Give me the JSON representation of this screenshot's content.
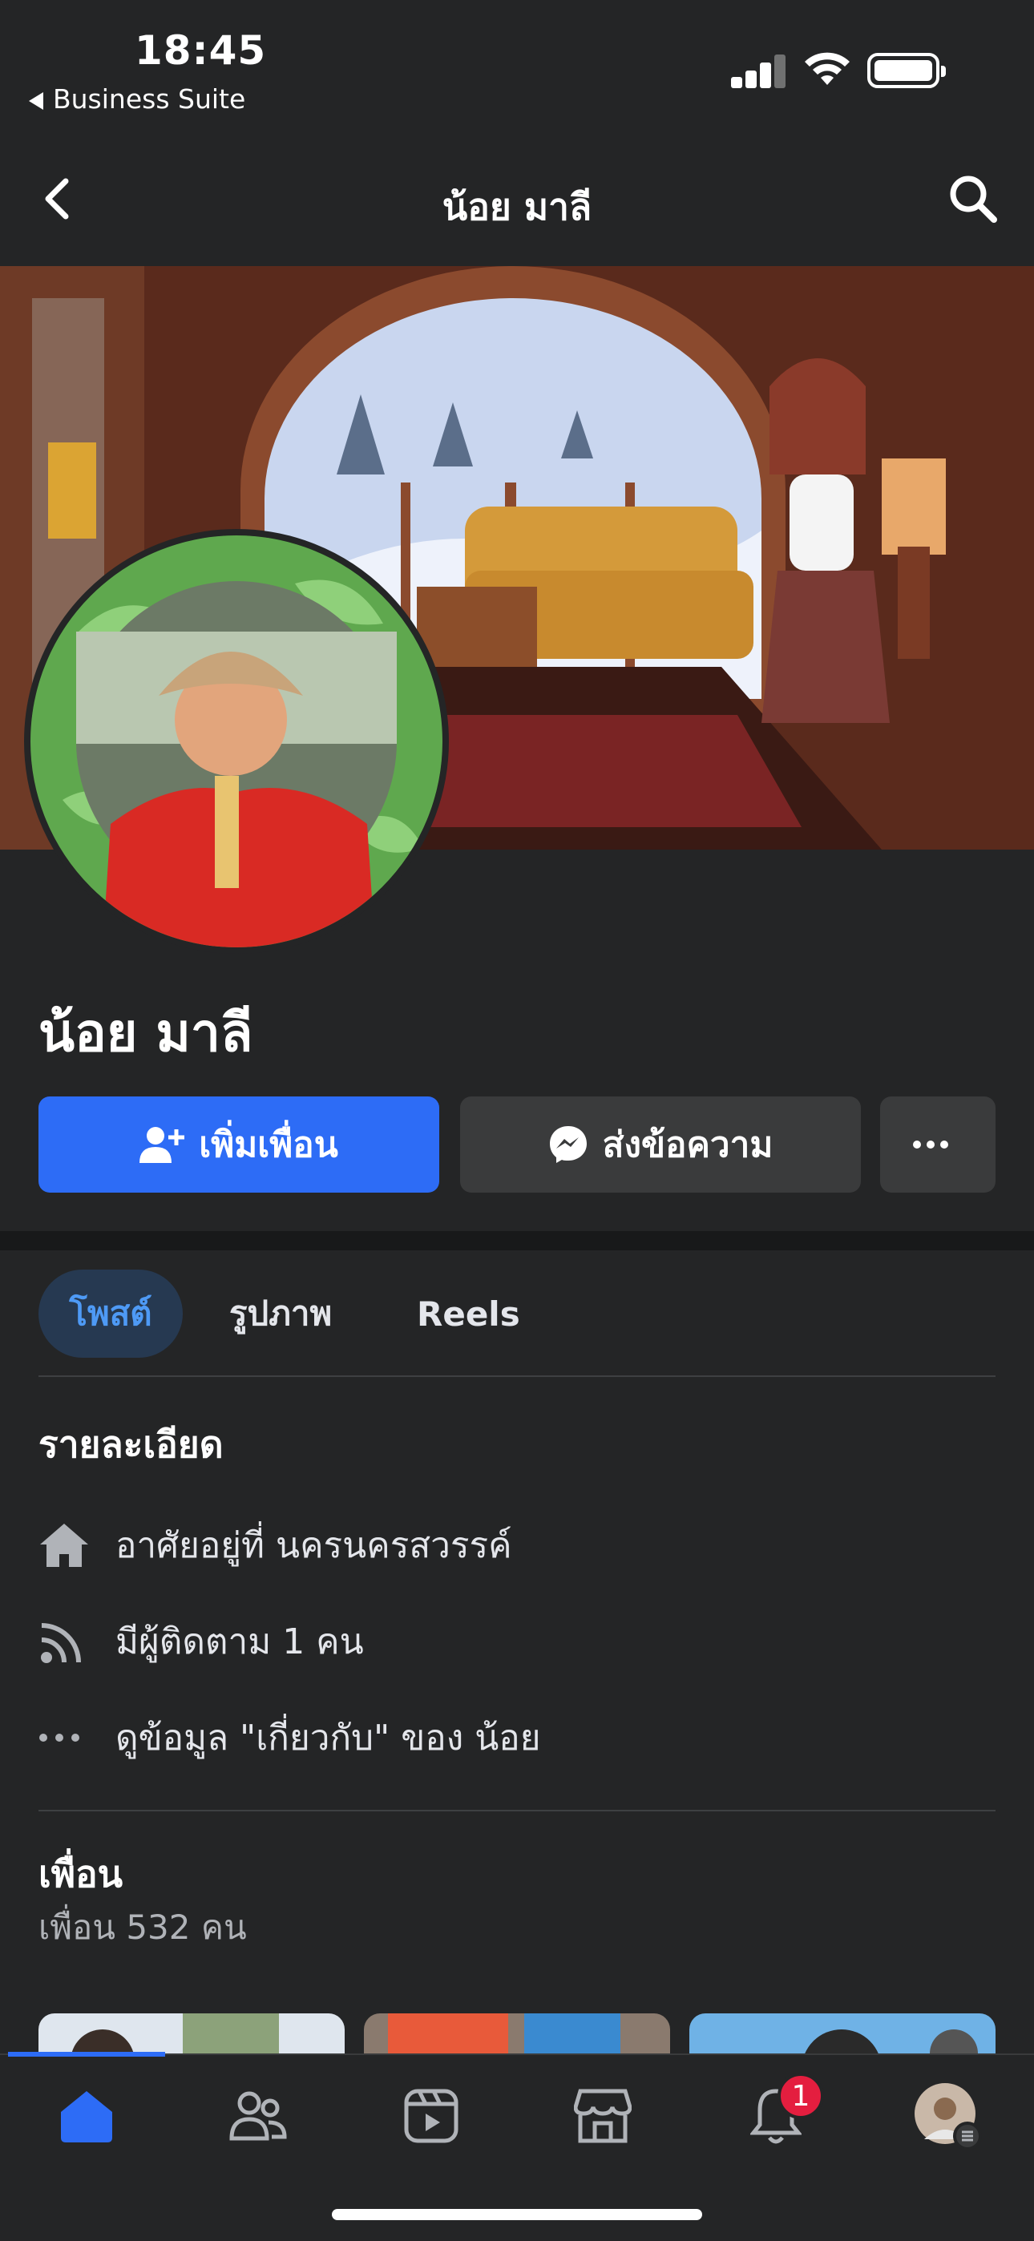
{
  "status_bar": {
    "time": "18:45",
    "back_app": "Business Suite"
  },
  "nav": {
    "title": "น้อย มาลี"
  },
  "profile": {
    "name": "น้อย มาลี"
  },
  "actions": {
    "add_friend": "เพิ่มเพื่อน",
    "message": "ส่งข้อความ",
    "more": "..."
  },
  "tabs": [
    {
      "label": "โพสต์",
      "active": true
    },
    {
      "label": "รูปภาพ",
      "active": false
    },
    {
      "label": "Reels",
      "active": false
    }
  ],
  "details": {
    "heading": "รายละเอียด",
    "lives_in": "อาศัยอยู่ที่ นครนครสวรรค์",
    "followers": "มีผู้ติดตาม 1 คน",
    "about": "ดูข้อมูล \"เกี่ยวกับ\" ของ น้อย"
  },
  "friends": {
    "heading": "เพื่อน",
    "count": "เพื่อน 532 คน"
  },
  "bottom_bar": {
    "tabs": [
      "home-icon",
      "friends-icon",
      "video-icon",
      "marketplace-icon",
      "notifications-icon",
      "profile-menu-icon"
    ],
    "notification_badge": "1",
    "active": "home-icon"
  },
  "colors": {
    "accent": "#2d6cf6",
    "background": "#242526",
    "button_secondary": "#3a3b3c",
    "badge": "#e41e3f"
  }
}
